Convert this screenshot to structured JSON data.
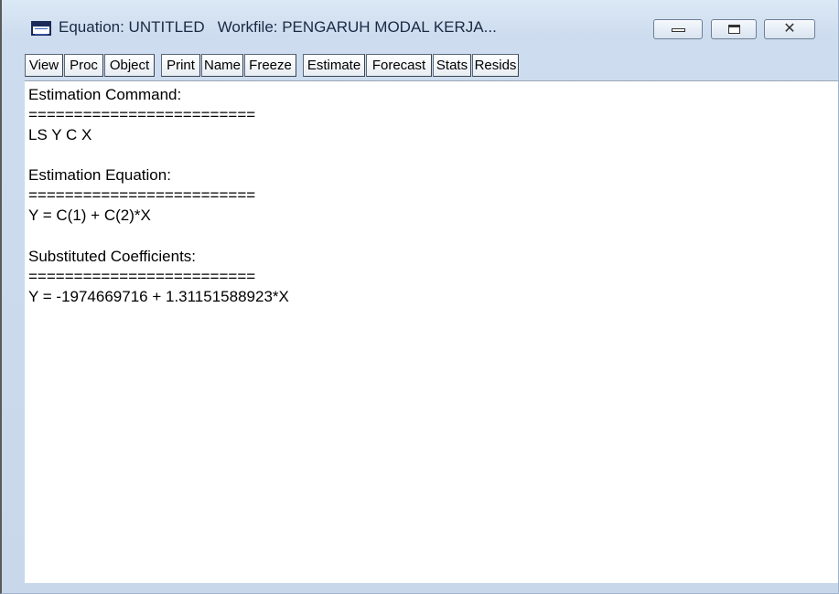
{
  "window": {
    "title_equation": "Equation: UNTITLED",
    "title_workfile": "Workfile: PENGARUH MODAL KERJA...",
    "close_glyph": "✕"
  },
  "toolbar": {
    "buttons": [
      "View",
      "Proc",
      "Object",
      "Print",
      "Name",
      "Freeze",
      "Estimate",
      "Forecast",
      "Stats",
      "Resids"
    ]
  },
  "output": {
    "estimation_command_heading": "Estimation Command:",
    "separator": "=========================",
    "estimation_command": "LS Y C X",
    "estimation_equation_heading": "Estimation Equation:",
    "estimation_equation": "Y = C(1) + C(2)*X",
    "substituted_coefficients_heading": "Substituted Coefficients:",
    "substituted_equation": "Y = -1974669716 + 1.31151588923*X"
  },
  "colors": {
    "frame_background": "#cddcee",
    "content_background": "#ffffff",
    "text": "#000000"
  },
  "icons": {
    "app": "equation-window-icon",
    "minimize": "minimize-icon",
    "maximize": "maximize-icon",
    "close": "close-icon"
  }
}
